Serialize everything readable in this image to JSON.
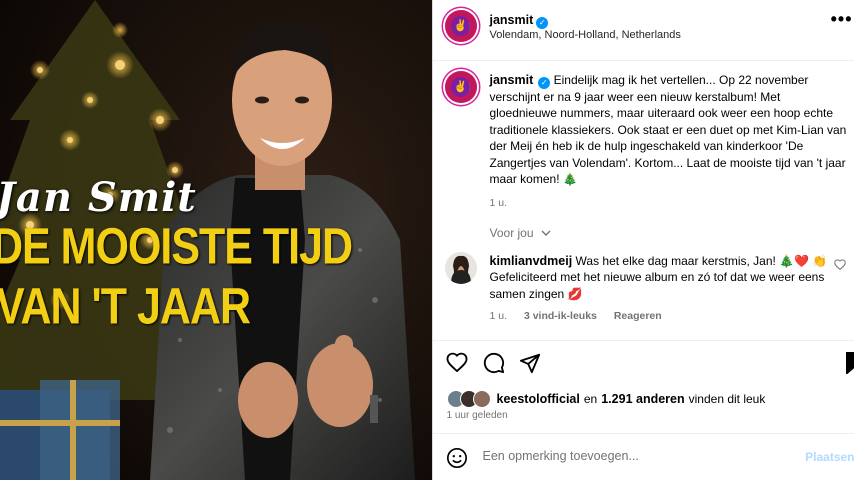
{
  "media": {
    "title_line1": "Jan Smit",
    "title_line2": "DE MOOISTE TIJD",
    "title_line3": "VAN 'T JAAR",
    "alt": "Jan Smit kerstalbum cover"
  },
  "header": {
    "username": "jansmit",
    "location": "Volendam, Noord-Holland, Netherlands",
    "more_icon": "more-horizontal-icon"
  },
  "caption": {
    "username": "jansmit",
    "text": "Eindelijk mag ik het vertellen... Op 22 november verschijnt er na 9 jaar weer een nieuw kerstalbum! Met gloednieuwe nummers, maar uiteraard ook weer een hoop echte traditionele klassiekers. Ook staat er een duet op met Kim-Lian van der Meij én heb ik de hulp ingeschakeld van kinderkoor 'De Zangertjes van Volendam'. Kortom... Laat de mooiste tijd van 't jaar maar komen! 🎄",
    "time": "1 u."
  },
  "feed_filter": {
    "label": "Voor jou",
    "icon": "chevron-down-icon"
  },
  "comment": {
    "username": "kimlianvdmeij",
    "text": "Was het elke dag maar kerstmis, Jan! 🎄❤️ 👏 Gefeliciteerd met het nieuwe album en zó tof dat we weer eens samen zingen 💋",
    "time": "1 u.",
    "likes": "3 vind-ik-leuks",
    "reply": "Reageren"
  },
  "actions": {
    "like_icon": "heart-icon",
    "comment_icon": "comment-icon",
    "share_icon": "send-icon",
    "save_icon": "bookmark-icon"
  },
  "likes_summary": {
    "liker": "keestolofficial",
    "connector": "en",
    "others": "1.291 anderen",
    "suffix": "vinden dit leuk"
  },
  "timestamp": "1 uur geleden",
  "add_comment": {
    "placeholder": "Een opmerking toevoegen...",
    "post_label": "Plaatsen",
    "emoji_icon": "emoji-icon"
  },
  "colors": {
    "accent": "#0095f6",
    "title_yellow": "#f3cf14",
    "muted": "#737373"
  }
}
